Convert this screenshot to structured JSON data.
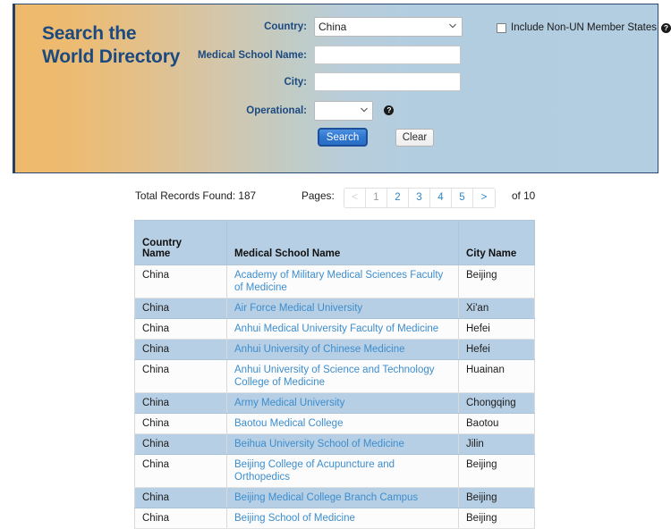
{
  "banner": {
    "title_line1": "Search the",
    "title_line2": "World Directory",
    "form": {
      "country_label": "Country:",
      "country_value": "China",
      "country_options": [
        "China"
      ],
      "school_label": "Medical School Name:",
      "school_value": "",
      "school_placeholder": "",
      "city_label": "City:",
      "city_value": "",
      "city_placeholder": "",
      "operational_label": "Operational:",
      "operational_value": "",
      "operational_options": [
        ""
      ],
      "operational_help_icon": "help-circle-icon",
      "search_button": "Search",
      "clear_button": "Clear"
    },
    "nonun": {
      "label": "Include Non-UN Member States",
      "checked": false,
      "help_icon": "help-circle-icon"
    }
  },
  "results": {
    "records_found": "Total Records Found: 187",
    "pages_label": "Pages:",
    "pager_items": [
      "<",
      "1",
      "2",
      "3",
      "4",
      "5",
      ">"
    ],
    "pager_current": "1",
    "pager_disabled": "<",
    "of_total": "of 10",
    "columns": [
      "Country Name",
      "Medical School Name",
      "City Name"
    ],
    "column_country_line1": "Country",
    "column_country_line2": "Name",
    "rows": [
      {
        "country": "China",
        "school": "Academy of Military Medical Sciences Faculty of Medicine",
        "city": "Beijing"
      },
      {
        "country": "China",
        "school": "Air Force Medical University",
        "city": "Xi'an"
      },
      {
        "country": "China",
        "school": "Anhui Medical University Faculty of Medicine",
        "city": "Hefei"
      },
      {
        "country": "China",
        "school": "Anhui University of Chinese Medicine",
        "city": "Hefei"
      },
      {
        "country": "China",
        "school": "Anhui University of Science and Technology College of Medicine",
        "city": "Huainan"
      },
      {
        "country": "China",
        "school": "Army Medical University",
        "city": "Chongqing"
      },
      {
        "country": "China",
        "school": "Baotou Medical College",
        "city": "Baotou"
      },
      {
        "country": "China",
        "school": "Beihua University School of Medicine",
        "city": "Jilin"
      },
      {
        "country": "China",
        "school": "Beijing College of Acupuncture and Orthopedics",
        "city": "Beijing"
      },
      {
        "country": "China",
        "school": "Beijing Medical College Branch Campus",
        "city": "Beijing"
      },
      {
        "country": "China",
        "school": "Beijing School of Medicine",
        "city": "Beijing"
      }
    ]
  },
  "colors": {
    "banner_gradient_start": "#eeb96a",
    "banner_gradient_end": "#b3cde0",
    "banner_border": "#2b4a72",
    "title_blue": "#1c4a80",
    "link_blue": "#3c8dce",
    "table_header_blue": "#b7cfe4",
    "row_alt_blue": "#b7cfe4",
    "search_button_blue": "#2e76cf"
  }
}
